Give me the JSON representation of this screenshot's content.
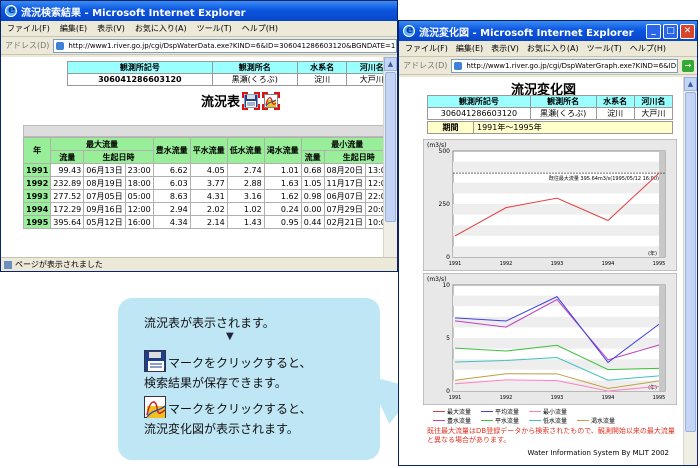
{
  "win1": {
    "title": "流況検索結果 - Microsoft Internet Explorer",
    "menu": [
      "ファイル(F)",
      "編集(E)",
      "表示(V)",
      "お気に入り(A)",
      "ツール(T)",
      "ヘルプ(H)"
    ],
    "address_label": "アドレス(D)",
    "address": "http://www1.river.go.jp/cgi/DspWaterData.exe?KIND=6&ID=306041286603120&BGNDATE=19910131&ENDDATE=199512",
    "info_headers": [
      "観測所記号",
      "観測所名",
      "水系名",
      "河川名"
    ],
    "info_values": [
      "306041286603120",
      "黒瀬(くろぶ)",
      "淀川",
      "大戸川"
    ],
    "heading": "流況表",
    "table_headers": {
      "year": "年",
      "max_group": "最大流量",
      "min_group": "最小流量",
      "flow": "流量",
      "datetime": "生起日時",
      "abundant": "豊水流量",
      "normal": "平水流量",
      "low": "低水流量",
      "drought": "渇水流量",
      "avg_partial": "平"
    },
    "rows": [
      {
        "year": "1991",
        "max": "99.43",
        "maxd": "06月13日",
        "maxt": "23:00",
        "a": "6.62",
        "n": "4.05",
        "l": "2.74",
        "d": "1.01",
        "min": "0.68",
        "mind": "08月20日",
        "mint": "13:00"
      },
      {
        "year": "1992",
        "max": "232.89",
        "maxd": "08月19日",
        "maxt": "18:00",
        "a": "6.03",
        "n": "3.77",
        "l": "2.88",
        "d": "1.63",
        "min": "1.05",
        "mind": "11月17日",
        "mint": "12:00"
      },
      {
        "year": "1993",
        "max": "277.52",
        "maxd": "07月05日",
        "maxt": "05:00",
        "a": "8.63",
        "n": "4.31",
        "l": "3.16",
        "d": "1.62",
        "min": "0.98",
        "mind": "06月07日",
        "mint": "22:00"
      },
      {
        "year": "1994",
        "max": "172.29",
        "maxd": "09月16日",
        "maxt": "12:00",
        "a": "2.94",
        "n": "2.02",
        "l": "1.02",
        "d": "0.24",
        "min": "0.00",
        "mind": "07月29日",
        "mint": "20:00"
      },
      {
        "year": "1995",
        "max": "395.64",
        "maxd": "05月12日",
        "maxt": "16:00",
        "a": "4.34",
        "n": "2.14",
        "l": "1.43",
        "d": "0.95",
        "min": "0.44",
        "mind": "02月21日",
        "mint": "10:00"
      }
    ],
    "status": "ページが表示されました"
  },
  "win2": {
    "title": "流況変化図 - Microsoft Internet Explorer",
    "menu": [
      "ファイル(F)",
      "編集(E)",
      "表示(V)",
      "お気に入り(A)",
      "ツール(T)",
      "ヘルプ(H)"
    ],
    "address_label": "アドレス(D)",
    "address": "http://www1.river.go.jp/cgi/DspWaterGraph.exe?KIND=6&ID=306041286603120",
    "heading": "流況変化図",
    "info_headers": [
      "観測所記号",
      "観測所名",
      "水系名",
      "河川名"
    ],
    "info_values": [
      "306041286603120",
      "黒瀬(くろぶ)",
      "淀川",
      "大戸川"
    ],
    "period_label": "期間",
    "period_value": "1991年～1995年",
    "chart1_unit": "(m3/s)",
    "chart1_note": "既往最大流量 395.64m3/s(1995/05/12 16:00)",
    "chart2_unit": "(m3/s)",
    "year_unit": "(年)",
    "legend": [
      "最大流量",
      "平均流量",
      "最小流量",
      "豊水流量",
      "平水流量",
      "低水流量",
      "渇水流量"
    ],
    "warning": "既往最大流量はDB登録データから検索されたもので、観測開始以来の最大流量と異なる場合があります。",
    "footer": "Water Information System By MLIT 2002"
  },
  "callout": {
    "line1": "流況表が表示されます。",
    "arrow": "▼",
    "line2a": "マークをクリックすると、",
    "line2b": "検索結果が保存できます。",
    "line3a": "マークをクリックすると、",
    "line3b": "流況変化図が表示されます。"
  },
  "chart_data": [
    {
      "type": "line",
      "x": [
        "1991",
        "1992",
        "1993",
        "1994",
        "1995"
      ],
      "ylim": [
        0,
        500
      ],
      "yticks": [
        "0",
        "250",
        "500"
      ],
      "series": [
        {
          "name": "最大流量",
          "values": [
            99.43,
            232.89,
            277.52,
            172.29,
            395.64
          ],
          "color": "#e04040"
        }
      ],
      "reference_line": 395.64
    },
    {
      "type": "line",
      "x": [
        "1991",
        "1992",
        "1993",
        "1994",
        "1995"
      ],
      "ylim": [
        0,
        10
      ],
      "yticks": [
        "0",
        "5",
        "10"
      ],
      "series": [
        {
          "name": "豊水流量",
          "values": [
            6.62,
            6.03,
            8.63,
            2.94,
            4.34
          ],
          "color": "#c040c0"
        },
        {
          "name": "平均流量",
          "values": [
            6.9,
            6.6,
            8.9,
            2.7,
            6.3
          ],
          "color": "#4040e0"
        },
        {
          "name": "平水流量",
          "values": [
            4.05,
            3.77,
            4.31,
            2.02,
            2.14
          ],
          "color": "#40c040"
        },
        {
          "name": "低水流量",
          "values": [
            2.74,
            2.88,
            3.16,
            1.02,
            1.43
          ],
          "color": "#40c0c0"
        },
        {
          "name": "渇水流量",
          "values": [
            1.01,
            1.63,
            1.62,
            0.24,
            0.95
          ],
          "color": "#c0a040"
        },
        {
          "name": "最小流量",
          "values": [
            0.68,
            1.05,
            0.98,
            0.0,
            0.44
          ],
          "color": "#ff80c0"
        }
      ]
    }
  ]
}
